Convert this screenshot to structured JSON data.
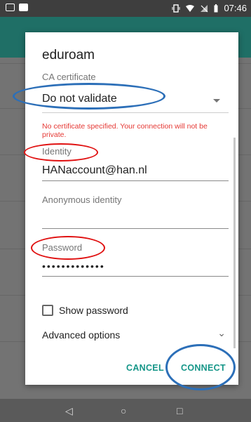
{
  "status_bar": {
    "time": "07:46"
  },
  "dialog": {
    "title": "eduroam",
    "ca_certificate_label": "CA certificate",
    "ca_certificate_value": "Do not validate",
    "error_text": "No certificate specified. Your connection will not be private.",
    "identity_label": "Identity",
    "identity_value": "HANaccount@han.nl",
    "anonymous_identity_label": "Anonymous identity",
    "anonymous_identity_value": "",
    "password_label": "Password",
    "password_value": "•••••••••••••",
    "show_password_label": "Show password",
    "show_password_checked": false,
    "advanced_options_label": "Advanced options",
    "cancel_label": "CANCEL",
    "connect_label": "CONNECT"
  },
  "colors": {
    "accent": "#159688",
    "error": "#e53935",
    "annotation_red": "#e01010",
    "annotation_blue": "#2c6fb8"
  }
}
